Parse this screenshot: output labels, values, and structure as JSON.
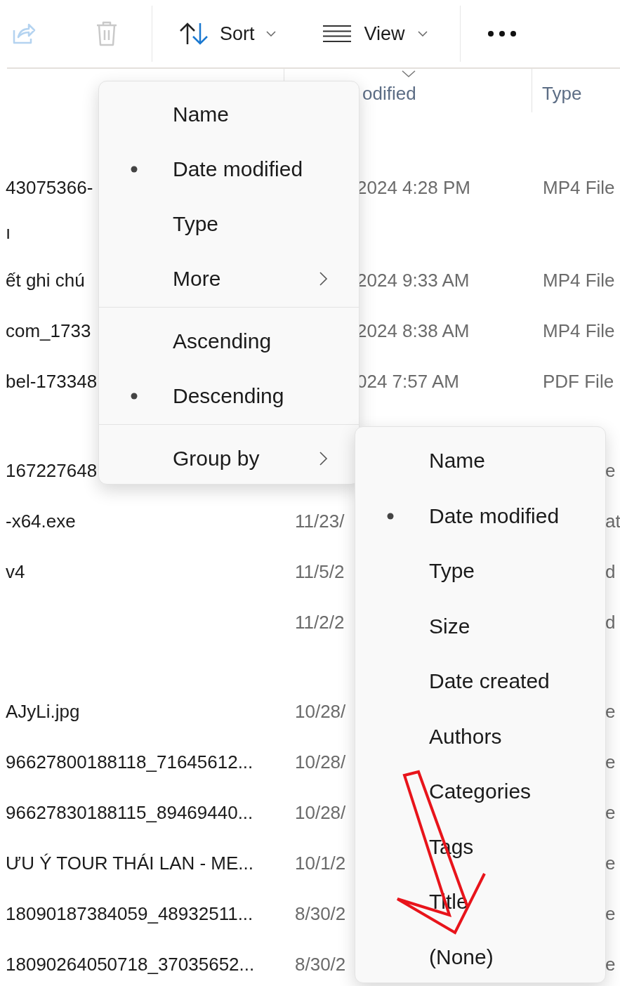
{
  "toolbar": [
    {
      "kind": "share",
      "disabled": true
    },
    {
      "kind": "delete",
      "disabled": true
    },
    {
      "kind": "sort",
      "label": "Sort"
    },
    {
      "kind": "view",
      "label": "View"
    },
    {
      "kind": "more"
    }
  ],
  "columns": {
    "date": "odified",
    "type": "Type"
  },
  "rows": [
    {
      "name": "43075366-",
      "date": "2024 4:28 PM",
      "type": "MP4 File"
    },
    {
      "name": "ı"
    },
    {
      "name": "ết ghi chú",
      "date": "2024 9:33 AM",
      "type": "MP4 File"
    },
    {
      "name": "com_1733",
      "date": "2024 8:38 AM",
      "type": "MP4 File"
    },
    {
      "name": "bel-173348",
      "date": "024 7:57 AM",
      "type": "PDF File"
    },
    {
      "name": "167227648",
      "type": "e"
    },
    {
      "name": "-x64.exe",
      "date": "11/23/",
      "type": "at"
    },
    {
      "name": "v4",
      "date": "11/5/2",
      "type": "d"
    },
    {
      "date": "11/2/2",
      "type": "d"
    },
    {
      "name": "AJyLi.jpg",
      "date": "10/28/",
      "type": "e"
    },
    {
      "name": "96627800188118_71645612...",
      "date": "10/28/",
      "type": "e"
    },
    {
      "name": "96627830188115_89469440...",
      "date": "10/28/",
      "type": "e"
    },
    {
      "name": "ƯU Ý TOUR THÁI LAN - ME...",
      "date": "10/1/2",
      "type": "e"
    },
    {
      "name": "18090187384059_48932511...",
      "date": "8/30/2",
      "type": "e"
    },
    {
      "name": "18090264050718_37035652...",
      "date": "8/30/2",
      "type": "e"
    }
  ],
  "sort_menu": {
    "sort_by": [
      {
        "label": "Name",
        "selected": false
      },
      {
        "label": "Date modified",
        "selected": true
      },
      {
        "label": "Type",
        "selected": false
      }
    ],
    "more": "More",
    "order": [
      {
        "label": "Ascending",
        "selected": false
      },
      {
        "label": "Descending",
        "selected": true
      }
    ],
    "group_by": "Group by"
  },
  "group_menu": {
    "items": [
      {
        "label": "Name",
        "selected": false
      },
      {
        "label": "Date modified",
        "selected": true
      },
      {
        "label": "Type",
        "selected": false
      },
      {
        "label": "Size",
        "selected": false
      },
      {
        "label": "Date created",
        "selected": false
      },
      {
        "label": "Authors",
        "selected": false
      },
      {
        "label": "Categories",
        "selected": false
      },
      {
        "label": "Tags",
        "selected": false
      },
      {
        "label": "Title",
        "selected": false
      },
      {
        "label": "(None)",
        "selected": false
      }
    ]
  }
}
